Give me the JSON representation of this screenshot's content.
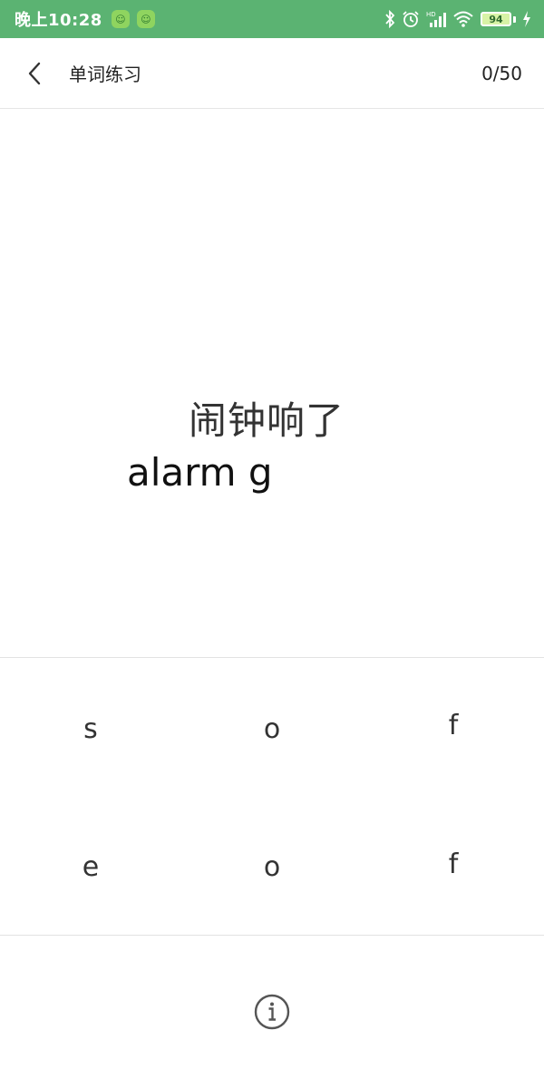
{
  "status_bar": {
    "time": "晚上10:28",
    "battery": "94"
  },
  "header": {
    "title": "单词练习",
    "progress": "0/50"
  },
  "question": {
    "chinese": "闹钟响了",
    "answer": "alarm g"
  },
  "letters": {
    "row1": [
      "s",
      "o",
      "f"
    ],
    "row2": [
      "e",
      "o",
      "f"
    ]
  },
  "colors": {
    "status_bar_bg": "#5bb372",
    "divider": "#e2e2e2"
  }
}
